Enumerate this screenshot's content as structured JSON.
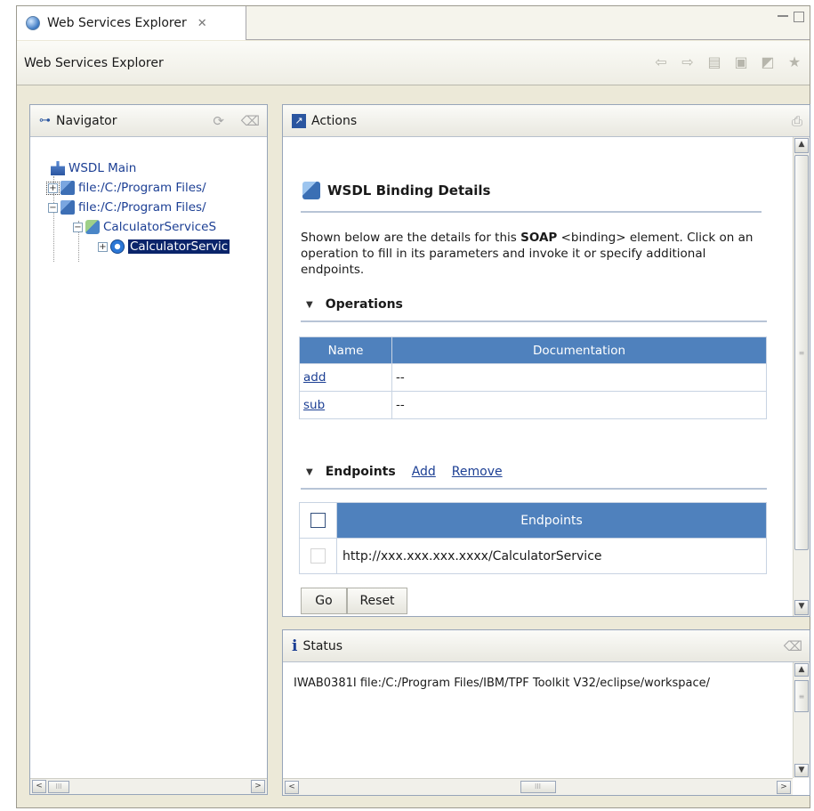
{
  "tab": {
    "title": "Web Services Explorer",
    "close": "✕"
  },
  "header": {
    "title": "Web Services Explorer"
  },
  "toolbar_icons": [
    "back-arrow-icon",
    "forward-arrow-icon",
    "page-icon",
    "copy-icon",
    "wsdl-icon",
    "favorites-icon"
  ],
  "navigator": {
    "title": "Navigator",
    "tree": [
      {
        "label": "WSDL Main"
      },
      {
        "label": "file:/C:/Program Files/",
        "expander": "+"
      },
      {
        "label": "file:/C:/Program Files/",
        "expander": "−"
      },
      {
        "label": "CalculatorServiceS",
        "expander": "−"
      },
      {
        "label": "CalculatorServic",
        "expander": "+"
      }
    ],
    "scroll": {
      "left": "<",
      "right": ">",
      "thumb": "III"
    }
  },
  "actions": {
    "title": "Actions",
    "binding_title": "WSDL Binding Details",
    "desc_prefix": "Shown below are the details for this ",
    "desc_bold": "SOAP",
    "desc_suffix": " <binding> element. Click on an operation to fill in its parameters and invoke it or specify additional endpoints.",
    "operations": {
      "title": "Operations",
      "headers": [
        "Name",
        "Documentation"
      ],
      "rows": [
        {
          "name": "add",
          "doc": "--"
        },
        {
          "name": "sub",
          "doc": "--"
        }
      ]
    },
    "endpoints": {
      "title": "Endpoints",
      "add": "Add",
      "remove": "Remove",
      "header": "Endpoints",
      "rows": [
        "http://xxx.xxx.xxx.xxxx/CalculatorService"
      ]
    },
    "go": "Go",
    "reset": "Reset"
  },
  "status": {
    "title": "Status",
    "icon": "i",
    "message": "IWAB0381I file:/C:/Program Files/IBM/TPF Toolkit V32/eclipse/workspace/",
    "scroll_thumb": "III"
  }
}
